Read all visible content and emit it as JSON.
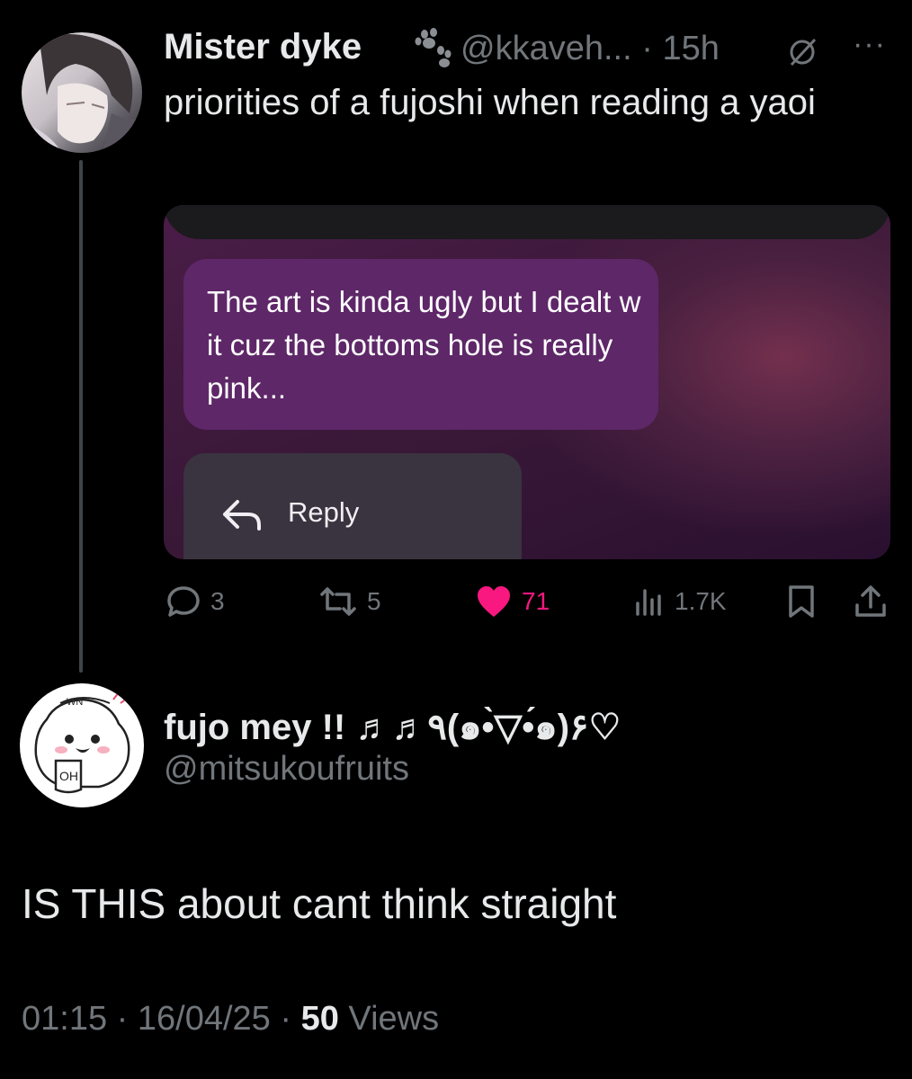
{
  "tweet_parent": {
    "display_name": "Mister dyke",
    "handle": "@kkaveh...",
    "separator": "·",
    "time": "15h",
    "text": "priorities of a fujoshi when reading a yaoi",
    "media": {
      "message_text": "The art is kinda ugly but I dealt w it cuz the bottoms hole is really pink...",
      "reply_label": "Reply"
    },
    "actions": {
      "replies": "3",
      "reposts": "5",
      "likes": "71",
      "views": "1.7K"
    }
  },
  "tweet_main": {
    "display_name": "fujo mey !! ♬♬٩(๑•̀▽•́๑)۶♡",
    "handle": "@mitsukoufruits",
    "text": "IS THIS about cant think straight",
    "time": "01:15",
    "date": "16/04/25",
    "views_count": "50",
    "views_label": "Views"
  },
  "colors": {
    "background": "#000000",
    "secondary_text": "#71767b",
    "like_active": "#f91880",
    "bubble": "#5e2768"
  }
}
